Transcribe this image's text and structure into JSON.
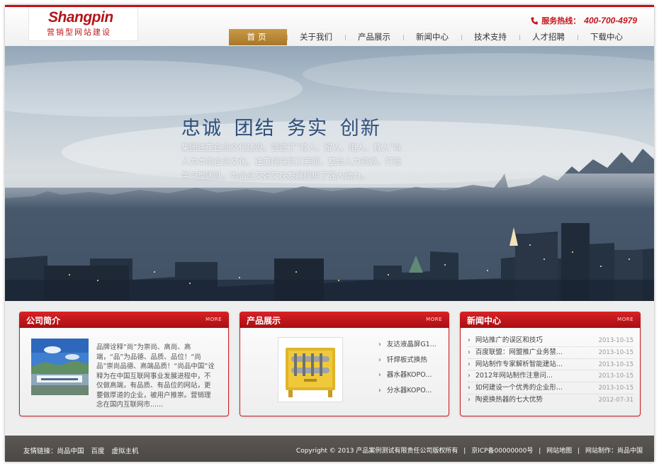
{
  "header": {
    "logo_text": "Shangpin",
    "logo_sub": "营销型网站建设",
    "hotline_label": "服务热线：",
    "hotline_number": "400-700-4979"
  },
  "nav": {
    "items": [
      "首页",
      "关于我们",
      "产品展示",
      "新闻中心",
      "技术支持",
      "人才招聘",
      "下载中心"
    ]
  },
  "banner": {
    "slogan": "忠诚 团结 务实 创新",
    "description": "集团注重企业文化建设，营造了“育人、留人、用人、育人”以人为本的企业文化，注重提高员工素质，整合人力资源，打造学习型团队，为企业又好又快发展提供了强大动力。"
  },
  "sections": {
    "intro": {
      "title": "公司简介",
      "more": "MORE",
      "text": "品牌诠释“尚”为崇尚、高尚、高端，“品”为品德、品质、品位！“尚品”崇尚品德、高端品质！“尚品中国”诠释为在中国互联网事业发展进程中，不仅做高端，有品质、有品位的网站，更要做厚道的企业，被用户推崇。营销理念在国内互联网市......"
    },
    "products": {
      "title": "产品展示",
      "more": "MORE",
      "items": [
        "友达液晶屏G1...",
        "钎焊板式换热",
        "器水器KOPO...",
        "分水器KOPO..."
      ]
    },
    "news": {
      "title": "新闻中心",
      "more": "MORE",
      "items": [
        {
          "title": "网站推广的误区和技巧",
          "date": "2013-10-15"
        },
        {
          "title": "百度联盟：网盟推广业务禁...",
          "date": "2013-10-15"
        },
        {
          "title": "网站制作专家解析智能建站...",
          "date": "2013-10-15"
        },
        {
          "title": "2012年网站制作注意问...",
          "date": "2013-10-15"
        },
        {
          "title": "如何建设一个优秀的企业形...",
          "date": "2013-10-15"
        },
        {
          "title": "陶瓷换热器的七大优势",
          "date": "2012-07-31"
        }
      ]
    }
  },
  "footer": {
    "links_label": "友情链接：",
    "links": [
      "尚品中国",
      "百度",
      "虚拟主机"
    ],
    "copyright": "Copyright © 2013 产品案例测试有限责任公司版权所有",
    "icp": "京ICP备00000000号",
    "sitemap": "网站地图",
    "maker": "网站制作：尚品中国"
  },
  "colors": {
    "brand_red": "#c4131a",
    "nav_active": "#b5832f",
    "footer_bg": "#524e4b"
  }
}
